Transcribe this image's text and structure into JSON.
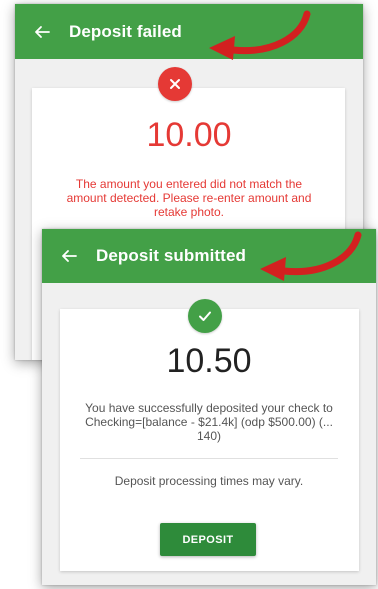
{
  "colors": {
    "appbar_green": "#43a047",
    "error_red": "#e53935",
    "success_green": "#43a047",
    "button_green": "#2e8b3a",
    "annotation_red": "#d32020"
  },
  "failed_screen": {
    "title": "Deposit failed",
    "back_icon": "arrow-left-icon",
    "status_icon": "close-icon",
    "amount": "10.00",
    "message": "The amount you entered did not match the amount detected. Please re-enter amount and retake photo."
  },
  "submitted_screen": {
    "title": "Deposit submitted",
    "back_icon": "arrow-left-icon",
    "status_icon": "check-icon",
    "amount": "10.50",
    "message": "You have successfully deposited your check to Checking=[balance - $21.4k] (odp $500.00) (... 140)",
    "note": "Deposit processing times may vary.",
    "button_label": "DEPOSIT"
  }
}
